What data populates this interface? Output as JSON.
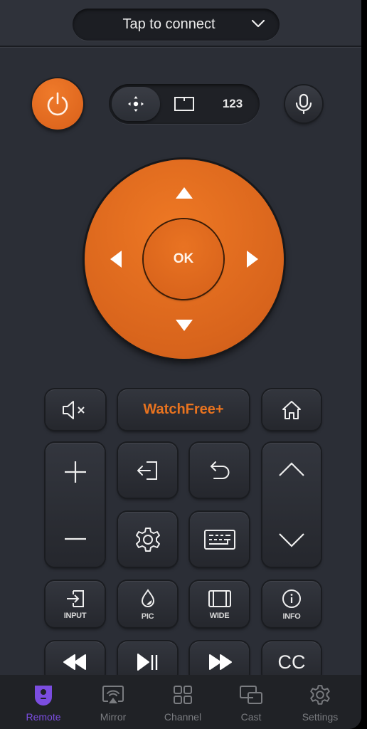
{
  "header": {
    "connect_label": "Tap to connect",
    "connect_icon": "chevron-down-icon"
  },
  "top_controls": {
    "power_icon": "power-icon",
    "mode_selector": [
      {
        "id": "dpad",
        "icon": "dpad-mode-icon",
        "active": true
      },
      {
        "id": "touchpad",
        "icon": "touchpad-icon",
        "active": false
      },
      {
        "id": "numpad",
        "label": "123",
        "active": false
      }
    ],
    "mic_icon": "microphone-icon"
  },
  "dpad": {
    "ok_label": "OK",
    "directions": [
      "up",
      "down",
      "left",
      "right"
    ]
  },
  "buttons": {
    "mute": {
      "icon": "mute-icon"
    },
    "watchfree": {
      "label": "WatchFree+"
    },
    "home": {
      "icon": "home-icon"
    },
    "volume": {
      "up_icon": "plus-icon",
      "down_icon": "minus-icon"
    },
    "exit": {
      "icon": "exit-icon"
    },
    "back": {
      "icon": "back-icon"
    },
    "settings": {
      "icon": "gear-icon"
    },
    "keyboard": {
      "icon": "keyboard-icon"
    },
    "channel": {
      "up_icon": "chevron-up-icon",
      "down_icon": "chevron-down-icon"
    },
    "input": {
      "label": "INPUT"
    },
    "pic": {
      "label": "PIC"
    },
    "wide": {
      "label": "WIDE"
    },
    "info": {
      "label": "INFO"
    },
    "rewind": {
      "icon": "rewind-icon"
    },
    "play_pause": {
      "icon": "play-pause-icon"
    },
    "fast_forward": {
      "icon": "fast-forward-icon"
    },
    "cc": {
      "label": "CC"
    }
  },
  "colors": {
    "accent": "#e06a1e",
    "nav_active": "#7b4de0",
    "watchfree_text": "#e8731f"
  },
  "nav": {
    "items": [
      {
        "label": "Remote",
        "icon": "remote-icon",
        "active": true
      },
      {
        "label": "Mirror",
        "icon": "mirror-icon",
        "active": false
      },
      {
        "label": "Channel",
        "icon": "grid-icon",
        "active": false
      },
      {
        "label": "Cast",
        "icon": "cast-icon",
        "active": false
      },
      {
        "label": "Settings",
        "icon": "settings-icon",
        "active": false
      }
    ]
  }
}
